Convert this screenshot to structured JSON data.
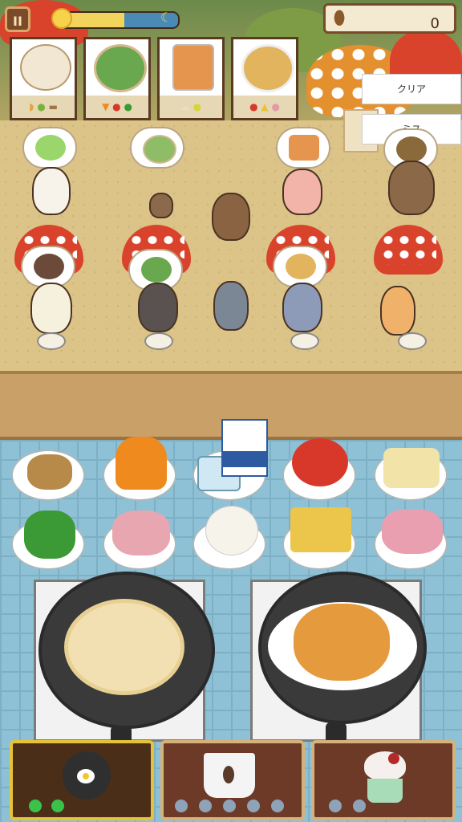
{
  "hud": {
    "pause_icon": "II",
    "time_progress": 0.55,
    "acorn_count": "0"
  },
  "orders": [
    {
      "dish": "cake",
      "dish_color": "#f1e7d2",
      "ingredients": [
        "taco",
        "lime",
        "bread"
      ]
    },
    {
      "dish": "salad",
      "dish_color": "#6aa84f",
      "ingredients": [
        "carrot",
        "tomato",
        "pepper"
      ]
    },
    {
      "dish": "juice",
      "dish_color": "#e6954f",
      "ingredients": [
        "cream",
        "lemon"
      ]
    },
    {
      "dish": "spaghetti",
      "dish_color": "#e2b45e",
      "ingredients": [
        "tomato",
        "cheese",
        "ham"
      ]
    }
  ],
  "side_buttons": {
    "clear_label": "クリア",
    "miss_label": "ミス"
  },
  "stations": {
    "fryer_slots": [
      "on",
      "on"
    ],
    "coffee_slots": [
      "off",
      "off",
      "off",
      "off",
      "off"
    ],
    "dessert_slots": [
      "off",
      "off"
    ]
  },
  "colors": {
    "mushroom_red": "#d9432c",
    "tile_blue": "#8fc1d6",
    "wood": "#6e3a28",
    "active_border": "#e6c23a"
  }
}
